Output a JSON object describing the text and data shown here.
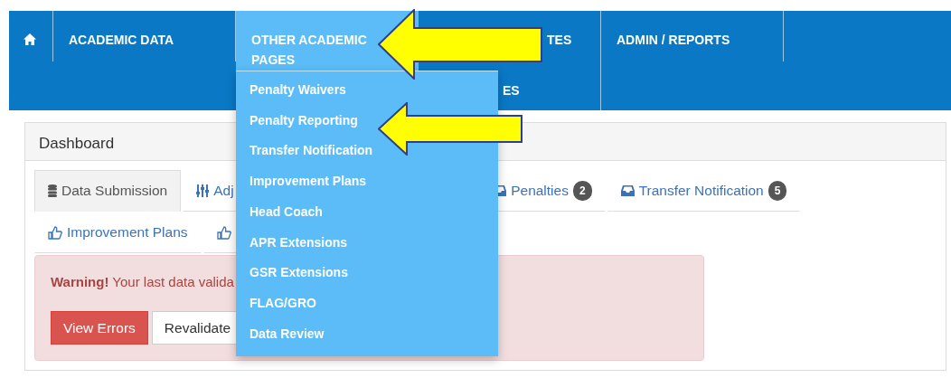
{
  "navbar": {
    "items": [
      {
        "kind": "home",
        "selected": false
      },
      {
        "kind": "text",
        "lines": [
          "ACADEMIC DATA"
        ],
        "selected": false
      },
      {
        "kind": "text",
        "lines": [
          "OTHER ACADEMIC",
          "PAGES"
        ],
        "selected": true
      },
      {
        "kind": "partial",
        "lines": [
          "TES",
          "ES"
        ],
        "selected": false
      },
      {
        "kind": "text",
        "lines": [
          "ADMIN / REPORTS"
        ],
        "selected": false
      }
    ]
  },
  "dropdown": {
    "items": [
      "Penalty Waivers",
      "Penalty Reporting",
      "Transfer Notification",
      "Improvement Plans",
      "Head Coach",
      "APR Extensions",
      "GSR Extensions",
      "FLAG/GRO",
      "Data Review"
    ]
  },
  "panel": {
    "title": "Dashboard",
    "tab_rows": [
      [
        {
          "kind": "database",
          "label": "Data Submission",
          "selected": true
        },
        {
          "kind": "sliders",
          "label": "Adj",
          "selected": false
        },
        {
          "kind": "inbox",
          "label": "Penalties",
          "badge": "2",
          "selected": false
        },
        {
          "kind": "inbox",
          "label": "Transfer Notification",
          "badge": "5",
          "selected": false
        }
      ],
      [
        {
          "kind": "thumb",
          "label": "Improvement Plans",
          "selected": false
        },
        {
          "kind": "thumb",
          "selected": false
        }
      ]
    ],
    "alert": {
      "text": "**Warning!** Your last data valida",
      "buttons": [
        {
          "kind": "danger",
          "label": "View Errors"
        },
        {
          "kind": "default",
          "label": "Revalidate"
        }
      ]
    }
  },
  "annotations": [
    {
      "kind": "arrow"
    },
    {
      "kind": "arrow"
    }
  ]
}
